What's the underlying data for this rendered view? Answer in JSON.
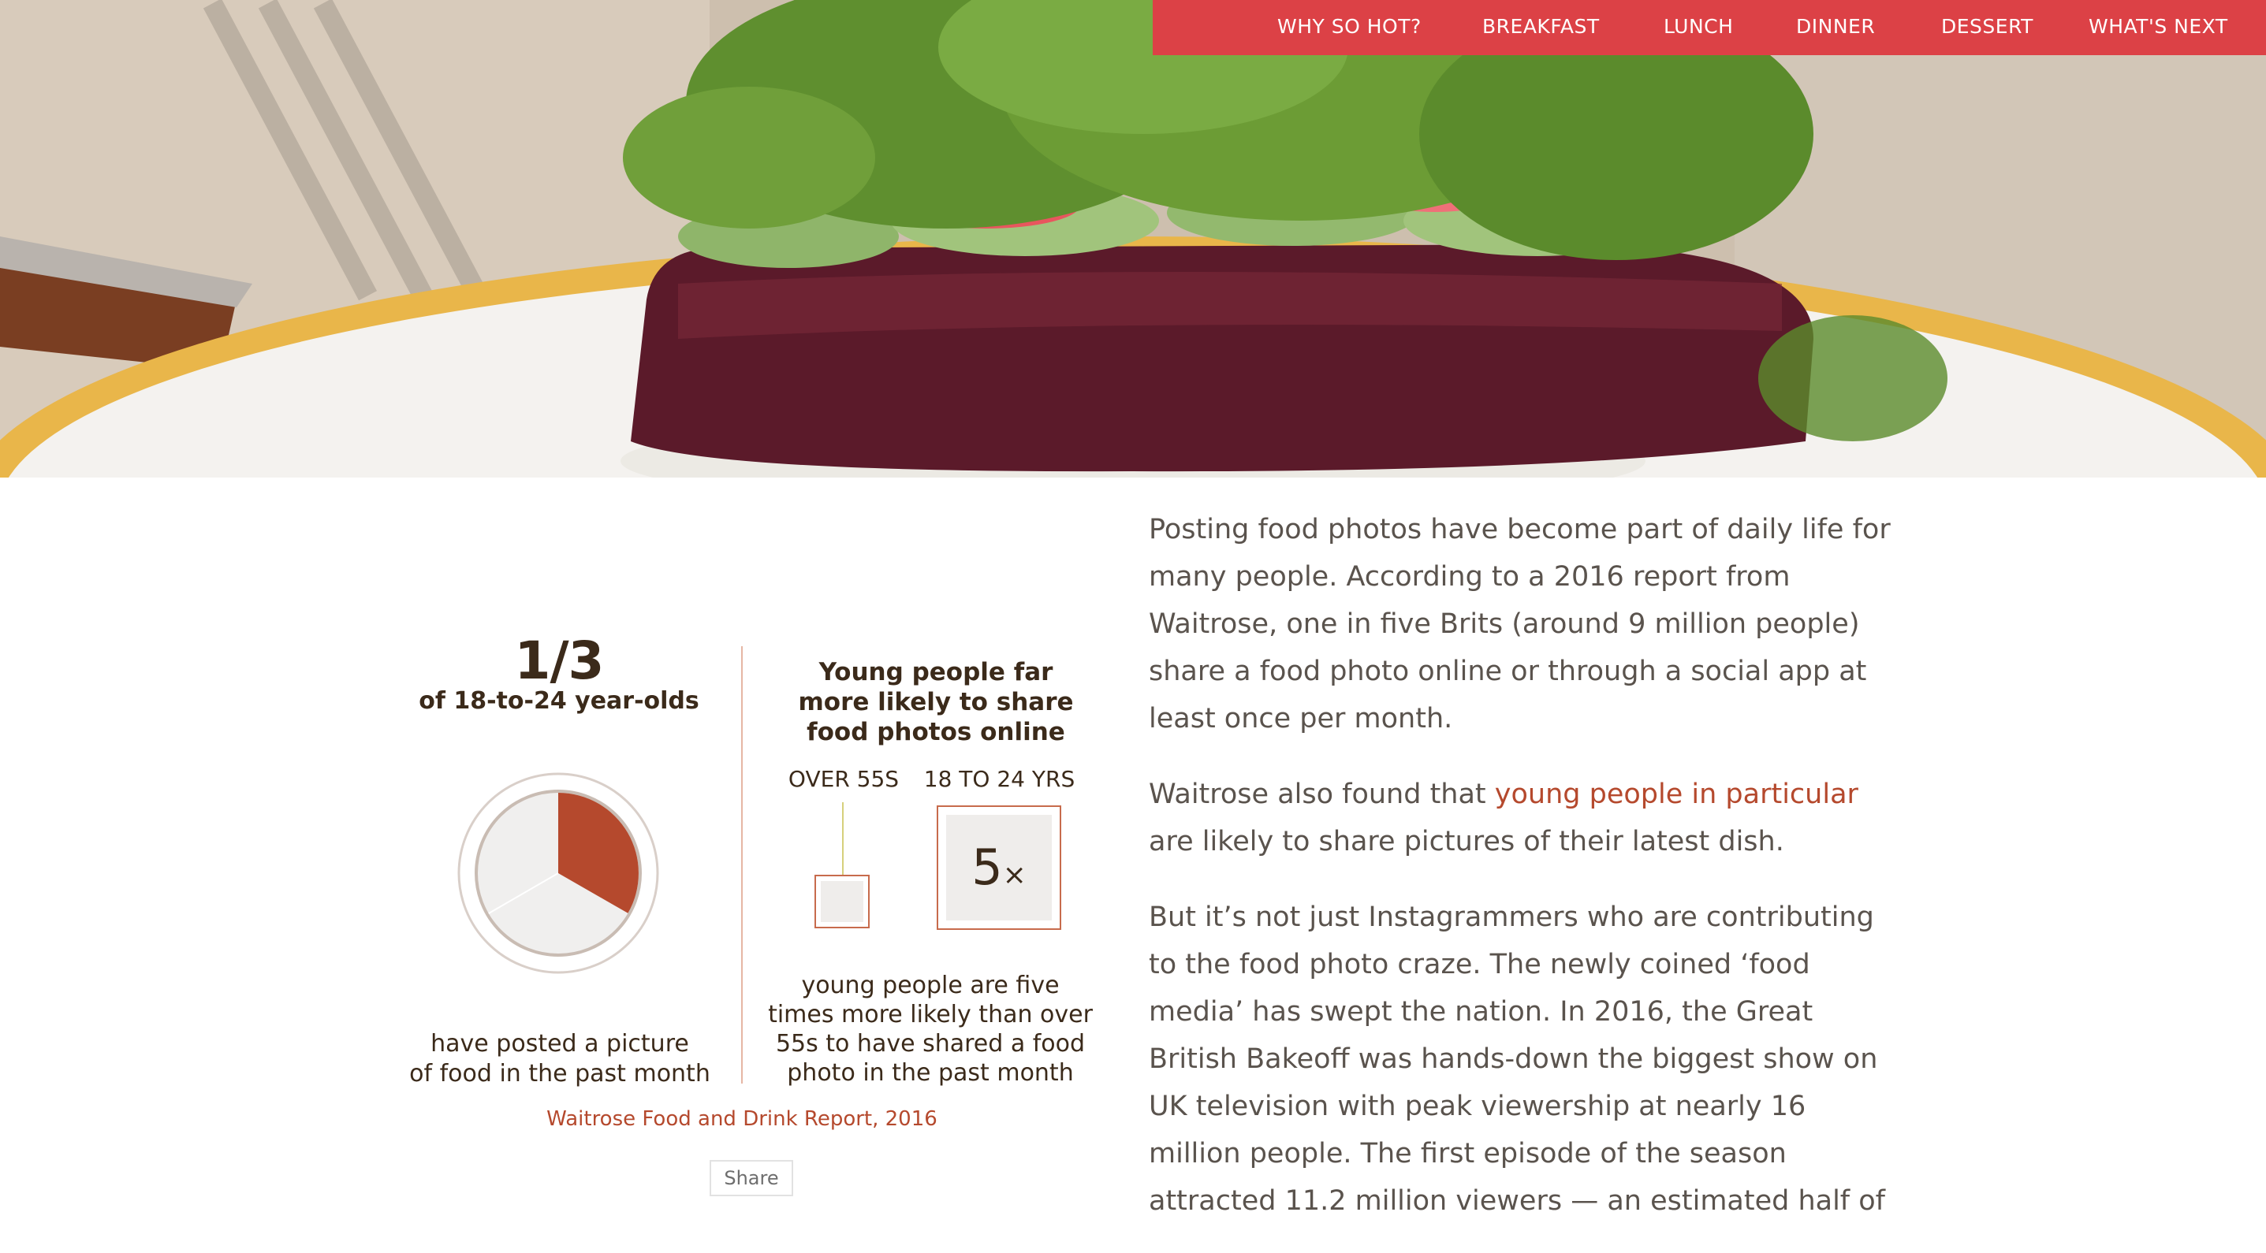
{
  "nav": {
    "items": [
      {
        "label": "WHY SO HOT?"
      },
      {
        "label": "BREAKFAST"
      },
      {
        "label": "LUNCH"
      },
      {
        "label": "DINNER"
      },
      {
        "label": "DESSERT"
      },
      {
        "label": "WHAT'S NEXT"
      }
    ],
    "background_color": "#dc4146"
  },
  "infographic": {
    "left": {
      "stat": "1/3",
      "subtitle": "of 18-to-24 year-olds",
      "pie_fraction": 0.333,
      "caption_line1": "have posted a picture",
      "caption_line2": "of food in the past month"
    },
    "right": {
      "heading_line1": "Young people far",
      "heading_line2": "more likely to share",
      "heading_line3": "food photos online",
      "label_over": "OVER 55S",
      "label_young": "18 TO 24 YRS",
      "multiplier_value": "5",
      "multiplier_symbol": "×",
      "caption_line1": "young people are five",
      "caption_line2": "times more likely than over",
      "caption_line3": "55s to have shared a food",
      "caption_line4": "photo in the past month"
    },
    "source": "Waitrose Food and Drink Report, 2016",
    "share_label": "Share",
    "accent_color": "#b5492d"
  },
  "article": {
    "p1": "Posting food photos have become part of daily life for many people. According to a 2016 report from Waitrose, one in five Brits (around 9 million people) share a food photo online or through a social app at least once per month.",
    "p2_before": "Waitrose also found that ",
    "p2_link": "young people in particular",
    "p2_after": " are likely to share pictures of their latest dish.",
    "p3": "But it’s not just Instagrammers who are contributing to the food photo craze. The newly coined ‘food media’ has swept the nation. In 2016, the Great British Bakeoff was hands-down the biggest show on UK television with peak viewership at nearly 16 million people. The first episode of the season attracted 11.2 million viewers — an estimated half of"
  }
}
